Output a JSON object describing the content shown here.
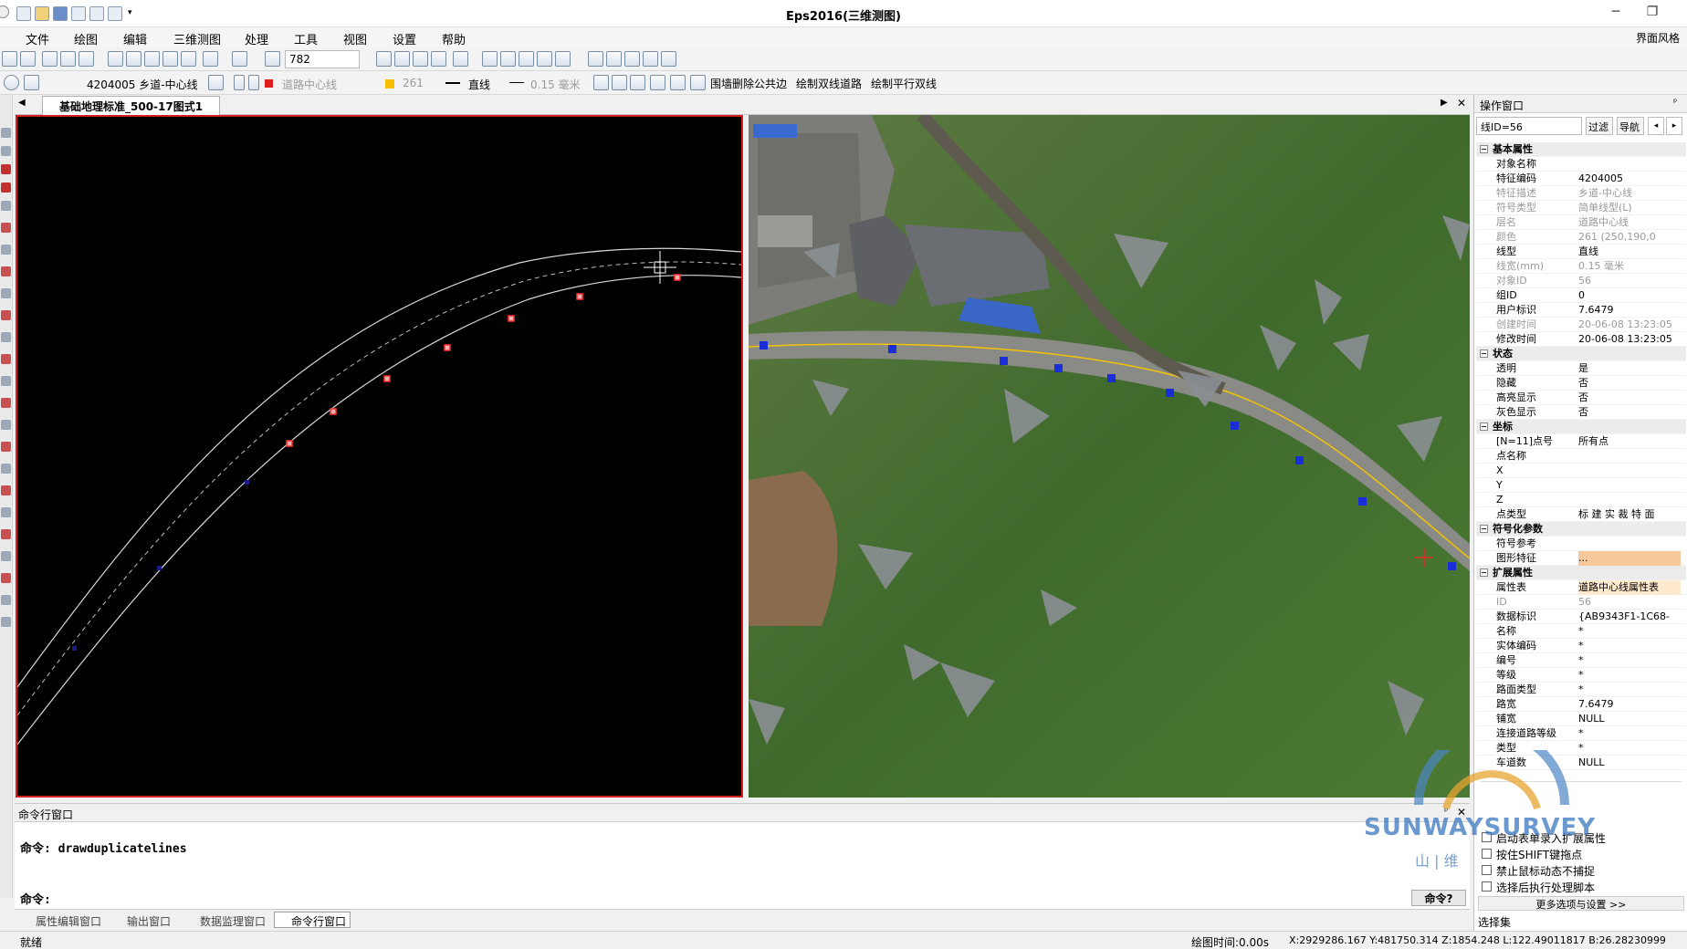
{
  "window": {
    "title": "Eps2016(三维测图)",
    "interface_style": "界面风格"
  },
  "menu": [
    "文件",
    "绘图",
    "编辑",
    "三维测图",
    "处理",
    "工具",
    "视图",
    "设置",
    "帮助"
  ],
  "toolbar1": {
    "scale_value": "782"
  },
  "toolbar2": {
    "code_combo": "4204005 乡道-中心线",
    "layer_combo": "道路中心线",
    "color_combo": "261",
    "linetype_combo": "直线",
    "linewidth_combo": "0.15 毫米",
    "actions": [
      "围墙删除公共边",
      "绘制双线道路",
      "绘制平行双线"
    ]
  },
  "document_tab": "基础地理标准_500-17图式1",
  "command_window": {
    "title": "命令行窗口",
    "history_line": "命令: drawduplicatelines",
    "prompt_label": "命令:",
    "prompt_button": "命令?"
  },
  "bottom_tabs": [
    "属性编辑窗口",
    "输出窗口",
    "数据监理窗口",
    "命令行窗口"
  ],
  "status": {
    "ready": "就绪",
    "draw_time": "绘图时间:0.00s",
    "coords": "X:2929286.167 Y:481750.314 Z:1854.248 L:122.49011817 B:26.28230999"
  },
  "right_panel": {
    "title": "操作窗口",
    "selector": "线ID=56",
    "filter_btn": "过滤",
    "nav_btn": "导航",
    "groups": [
      {
        "name": "基本属性",
        "rows": [
          {
            "k": "对象名称",
            "v": ""
          },
          {
            "k": "特征编码",
            "v": "4204005"
          },
          {
            "k": "特征描述",
            "v": "乡道-中心线",
            "dim": true
          },
          {
            "k": "符号类型",
            "v": "简单线型(L)",
            "dim": true
          },
          {
            "k": "层名",
            "v": "道路中心线",
            "dim": true
          },
          {
            "k": "颜色",
            "v": "261 (250,190,0",
            "dim": true
          },
          {
            "k": "线型",
            "v": "直线"
          },
          {
            "k": "线宽(mm)",
            "v": "0.15 毫米",
            "dim": true
          },
          {
            "k": "对象ID",
            "v": "56",
            "dim": true
          },
          {
            "k": "组ID",
            "v": "0"
          },
          {
            "k": "用户标识",
            "v": "7.6479"
          },
          {
            "k": "创建时间",
            "v": "20-06-08 13:23:05",
            "dim": true
          },
          {
            "k": "修改时间",
            "v": "20-06-08 13:23:05"
          }
        ]
      },
      {
        "name": "状态",
        "rows": [
          {
            "k": "透明",
            "v": "是"
          },
          {
            "k": "隐藏",
            "v": "否"
          },
          {
            "k": "高亮显示",
            "v": "否"
          },
          {
            "k": "灰色显示",
            "v": "否"
          }
        ]
      },
      {
        "name": "坐标",
        "rows": [
          {
            "k": "[N=11]点号",
            "v": "所有点"
          },
          {
            "k": "点名称",
            "v": ""
          },
          {
            "k": "X",
            "v": ""
          },
          {
            "k": "Y",
            "v": ""
          },
          {
            "k": "Z",
            "v": ""
          },
          {
            "k": "点类型",
            "v": "标 建 实 裁 特 面"
          }
        ]
      },
      {
        "name": "符号化参数",
        "rows": [
          {
            "k": "符号参考",
            "v": ""
          },
          {
            "k": "图形特征",
            "v": "..."
          }
        ]
      },
      {
        "name": "扩展属性",
        "rows": [
          {
            "k": "属性表",
            "v": "道路中心线属性表"
          },
          {
            "k": "ID",
            "v": "56",
            "dim": true
          },
          {
            "k": "数据标识",
            "v": "{AB9343F1-1C68-"
          },
          {
            "k": "名称",
            "v": "*"
          },
          {
            "k": "实体编码",
            "v": "*"
          },
          {
            "k": "编号",
            "v": "*"
          },
          {
            "k": "等级",
            "v": "*"
          },
          {
            "k": "路面类型",
            "v": "*"
          },
          {
            "k": "路宽",
            "v": "7.6479"
          },
          {
            "k": "铺宽",
            "v": "NULL"
          },
          {
            "k": "连接道路等级",
            "v": "*"
          },
          {
            "k": "类型",
            "v": "*"
          },
          {
            "k": "车道数",
            "v": "NULL"
          }
        ]
      }
    ],
    "options": [
      "启动表单录入扩展属性",
      "按住SHIFT键拖点",
      "禁止鼠标动态不捕捉",
      "选择后执行处理脚本"
    ],
    "more_options": "更多选项与设置 >>",
    "selection_set": "选择集"
  },
  "watermark": {
    "text": "SUNWAYSURVEY",
    "cn": "山 | 维"
  },
  "colors": {
    "selection_red": "#d42020",
    "vertex_blue": "#1a2ed8",
    "line_yellow": "#f5c400"
  }
}
